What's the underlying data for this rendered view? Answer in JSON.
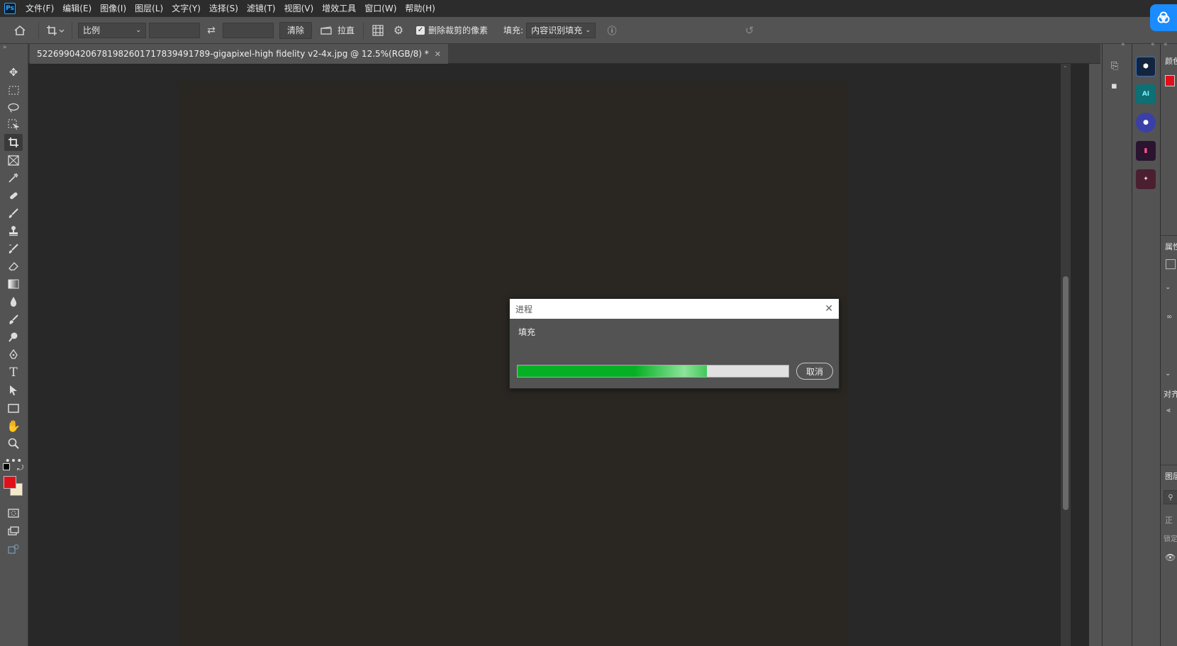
{
  "app": {
    "logo": "Ps"
  },
  "menu": [
    "文件(F)",
    "编辑(E)",
    "图像(I)",
    "图层(L)",
    "文字(Y)",
    "选择(S)",
    "滤镜(T)",
    "视图(V)",
    "增效工具",
    "窗口(W)",
    "帮助(H)"
  ],
  "options": {
    "ratio_label": "比例",
    "width_value": "",
    "height_value": "",
    "clear_label": "清除",
    "straighten_label": "拉直",
    "delete_cropped_label": "删除裁剪的像素",
    "delete_cropped_checked": true,
    "fill_label": "填充:",
    "fill_value": "内容识别填充"
  },
  "document": {
    "tab_title": "522699042067819826017178394917​89-gigapixel-high fidelity v2-4x.jpg @ 12.5%(RGB/8) *"
  },
  "dialog": {
    "title": "进程",
    "label": "填充",
    "progress": 0.7,
    "cancel_label": "取消"
  },
  "right_panels": {
    "color_label": "颜色",
    "properties_label": "属性",
    "align_label": "对齐",
    "layers_label": "图层",
    "kind_label": "正",
    "lock_label": "锁定"
  },
  "colors": {
    "foreground": "#e0101a",
    "background": "#f5e9cc",
    "progress_fill": "#06b025",
    "accent": "#1a8cff"
  },
  "icons": {
    "tools": [
      "move",
      "marquee",
      "lasso",
      "object-select",
      "crop",
      "frame",
      "eyedropper",
      "healing",
      "brush",
      "stamp",
      "history-brush",
      "eraser",
      "gradient",
      "blur",
      "dodge",
      "burn",
      "pen",
      "type",
      "path-select",
      "rectangle",
      "hand",
      "zoom",
      "more"
    ]
  }
}
